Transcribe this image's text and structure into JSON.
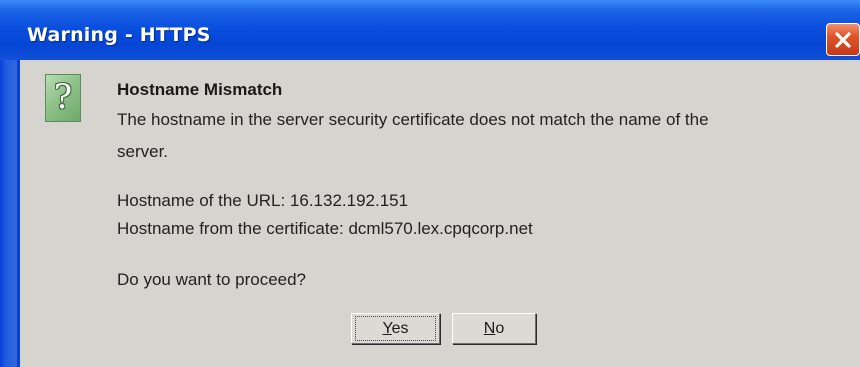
{
  "window": {
    "title": "Warning - HTTPS"
  },
  "dialog": {
    "heading": "Hostname Mismatch",
    "line1": "The hostname in the server security certificate does not match the name of the",
    "line2": "server.",
    "url_hostname": "Hostname of the URL: 16.132.192.151",
    "cert_hostname": "Hostname from the certificate: dcml570.lex.cpqcorp.net",
    "question": "Do you want to proceed?"
  },
  "buttons": {
    "yes": {
      "mnemonic": "Y",
      "rest": "es"
    },
    "no": {
      "mnemonic": "N",
      "rest": "o"
    }
  },
  "icons": {
    "dialog_icon": "question-icon",
    "close": "close-icon"
  }
}
